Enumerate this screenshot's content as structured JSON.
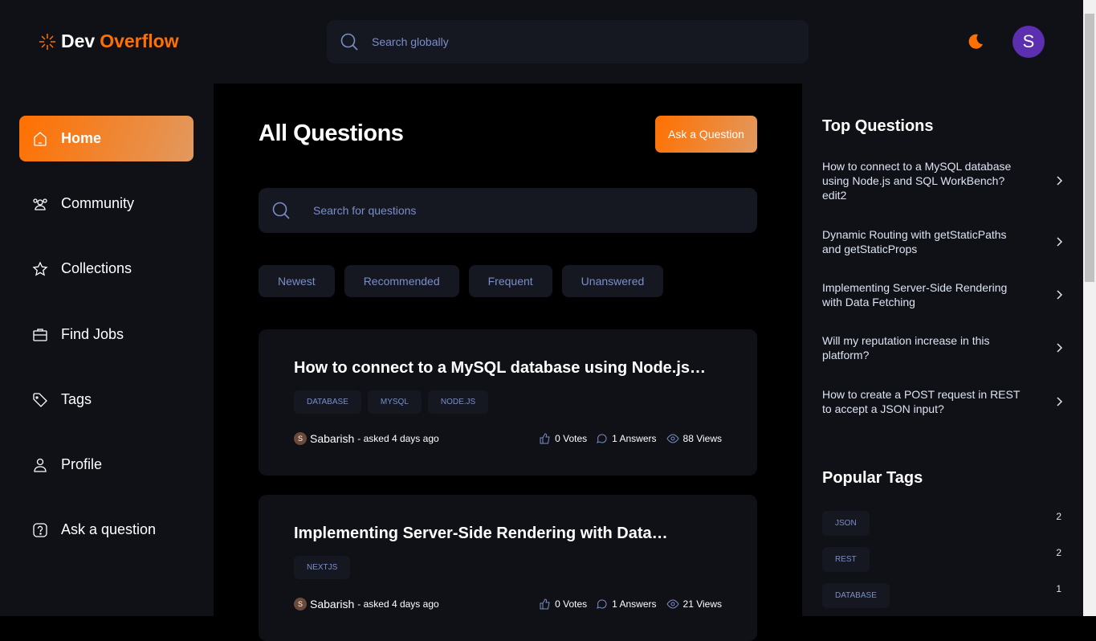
{
  "header": {
    "logo_part1": "Dev",
    "logo_part2": "Overflow",
    "search_placeholder": "Search globally",
    "avatar_initial": "S"
  },
  "sidebar": {
    "items": [
      {
        "label": "Home",
        "icon": "home-icon",
        "active": true
      },
      {
        "label": "Community",
        "icon": "users-icon"
      },
      {
        "label": "Collections",
        "icon": "star-icon"
      },
      {
        "label": "Find Jobs",
        "icon": "briefcase-icon"
      },
      {
        "label": "Tags",
        "icon": "tag-icon"
      },
      {
        "label": "Profile",
        "icon": "user-icon"
      },
      {
        "label": "Ask a question",
        "icon": "question-icon"
      }
    ]
  },
  "main": {
    "title": "All Questions",
    "ask_button": "Ask a Question",
    "search_placeholder": "Search for questions",
    "filters": [
      "Newest",
      "Recommended",
      "Frequent",
      "Unanswered"
    ],
    "questions": [
      {
        "title": "How to connect to a MySQL database using Node.js…",
        "tags": [
          "DATABASE",
          "MYSQL",
          "NODE.JS"
        ],
        "author": "Sabarish",
        "author_initial": "S",
        "asked": "- asked 4 days ago",
        "votes": "0 Votes",
        "answers": "1 Answers",
        "views": "88 Views"
      },
      {
        "title": "Implementing Server-Side Rendering with Data…",
        "tags": [
          "NEXTJS"
        ],
        "author": "Sabarish",
        "author_initial": "S",
        "asked": "- asked 4 days ago",
        "votes": "0 Votes",
        "answers": "1 Answers",
        "views": "21 Views"
      }
    ]
  },
  "right": {
    "top_title": "Top Questions",
    "top_questions": [
      "How to connect to a MySQL database using Node.js and SQL WorkBench? edit2",
      "Dynamic Routing with getStaticPaths and getStaticProps",
      "Implementing Server-Side Rendering with Data Fetching",
      "Will my reputation increase in this platform?",
      "How to create a POST request in REST to accept a JSON input?"
    ],
    "tags_title": "Popular Tags",
    "popular_tags": [
      {
        "name": "JSON",
        "count": "2"
      },
      {
        "name": "REST",
        "count": "2"
      },
      {
        "name": "DATABASE",
        "count": "1"
      }
    ]
  },
  "colors": {
    "accent": "#ff7000",
    "tag_text": "#7b8ec8",
    "panel": "#0f1117"
  }
}
